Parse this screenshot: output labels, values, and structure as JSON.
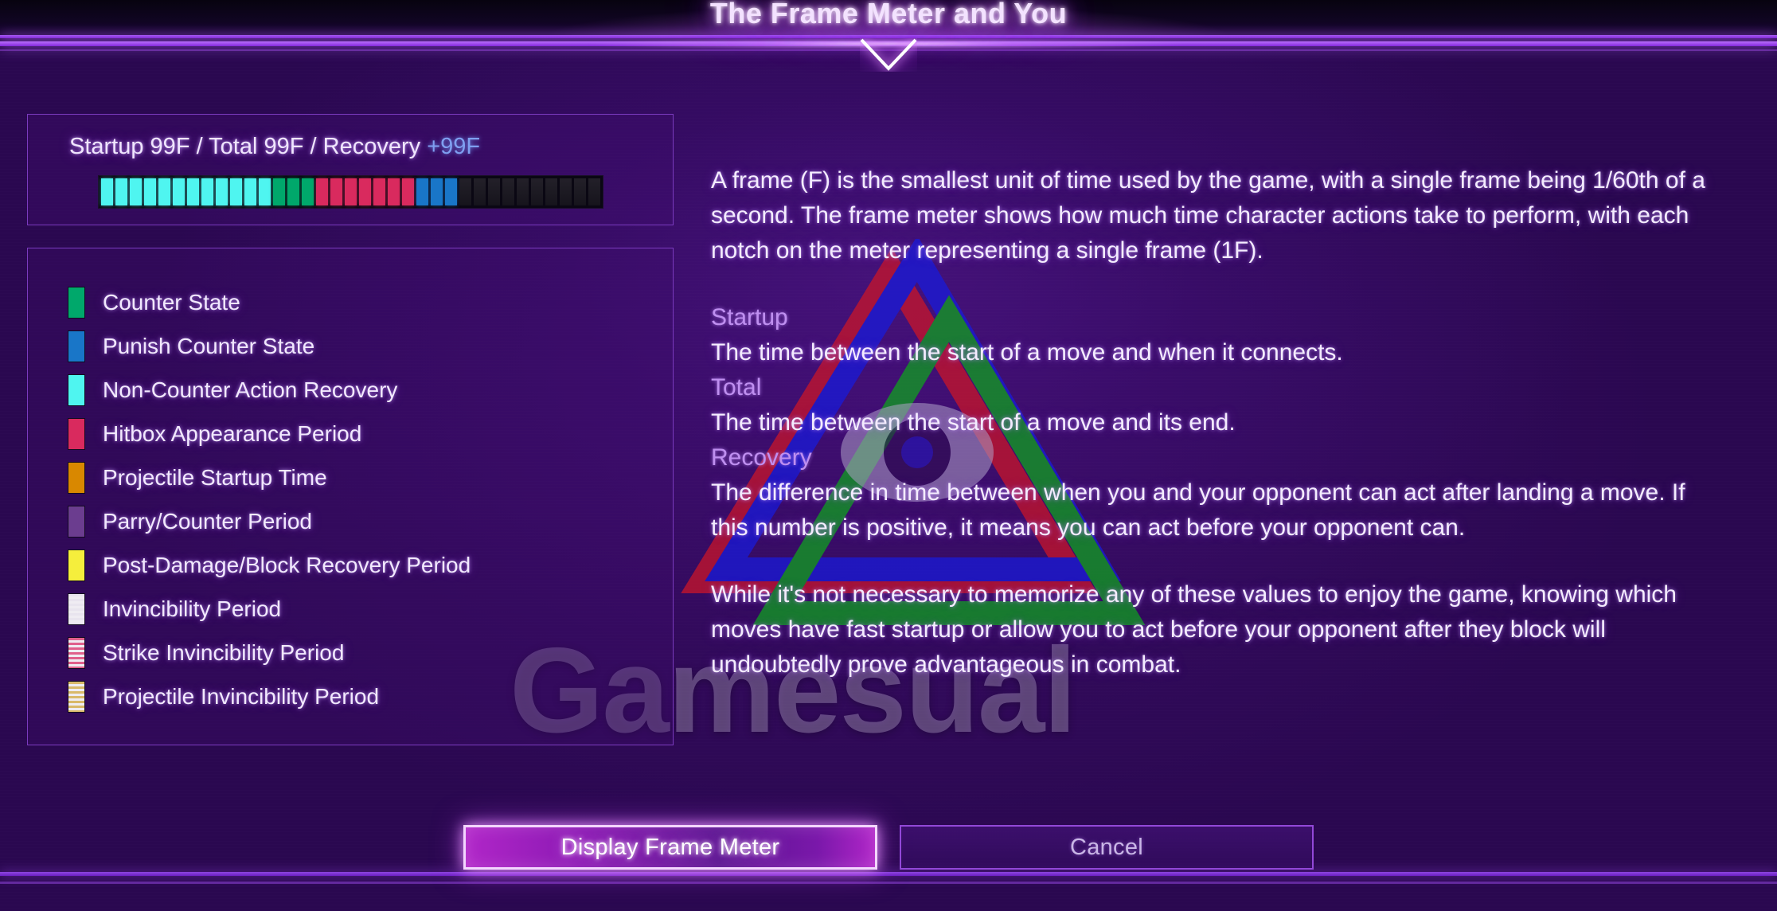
{
  "header": {
    "title": "The Frame Meter and You"
  },
  "meter": {
    "label_prefix": "Startup 99F / Total 99F / Recovery ",
    "label_recovery": "+99F",
    "recovery_color": "#7f9ff0",
    "startup_value": "99F",
    "total_value": "99F",
    "recovery_value": "+99F",
    "segments": [
      {
        "name": "non-counter-action-recovery",
        "color": "#4ff5f0",
        "count": 12
      },
      {
        "name": "counter-state",
        "color": "#00a86b",
        "count": 3
      },
      {
        "name": "hitbox-appearance-period",
        "color": "#d92a5e",
        "count": 7
      },
      {
        "name": "punish-counter-state",
        "color": "#1976c8",
        "count": 3
      },
      {
        "name": "empty",
        "color": "#1c1a22",
        "count": 10
      }
    ]
  },
  "legend": {
    "items": [
      {
        "label": "Counter State",
        "color": "#00a86b",
        "pattern": "solid"
      },
      {
        "label": "Punish Counter State",
        "color": "#1976c8",
        "pattern": "solid"
      },
      {
        "label": "Non-Counter Action Recovery",
        "color": "#4ff5f0",
        "pattern": "solid"
      },
      {
        "label": "Hitbox Appearance Period",
        "color": "#d92a5e",
        "pattern": "solid"
      },
      {
        "label": "Projectile Startup Time",
        "color": "#d98800",
        "pattern": "solid"
      },
      {
        "label": "Parry/Counter Period",
        "color": "#6b3d8f",
        "pattern": "solid"
      },
      {
        "label": "Post-Damage/Block Recovery Period",
        "color": "#f5ee3c",
        "pattern": "solid"
      },
      {
        "label": "Invincibility Period",
        "color": "#e8e4ee",
        "pattern": "striped"
      },
      {
        "label": "Strike Invincibility Period",
        "color": "#e0608c",
        "pattern": "striped"
      },
      {
        "label": "Projectile Invincibility Period",
        "color": "#d9b96a",
        "pattern": "striped"
      }
    ]
  },
  "description": {
    "paragraph1": "A frame (F) is the smallest unit of time used by the game, with a single frame being 1/60th of a second. The frame meter shows how much time character actions take to perform, with each notch on the meter representing a single frame (1F).",
    "terms": [
      {
        "term": "Startup",
        "definition": "The time between the start of a move and when it connects."
      },
      {
        "term": "Total",
        "definition": "The time between the start of a move and its end."
      },
      {
        "term": "Recovery",
        "definition": "The difference in time between when you and your opponent can act after landing a move. If this number is positive, it means you can act before your opponent can."
      }
    ],
    "paragraph2": "While it's not necessary to memorize any of these values to enjoy the game, knowing which moves have fast startup or allow you to act before your opponent after they block will undoubtedly prove advantageous in combat."
  },
  "buttons": {
    "primary": "Display Frame Meter",
    "secondary": "Cancel"
  },
  "watermark": {
    "text": "Gamesual"
  },
  "colors": {
    "accent_purple": "#b96ffc",
    "panel_border": "#7b3bbf",
    "term_color": "#bf8ff0"
  }
}
